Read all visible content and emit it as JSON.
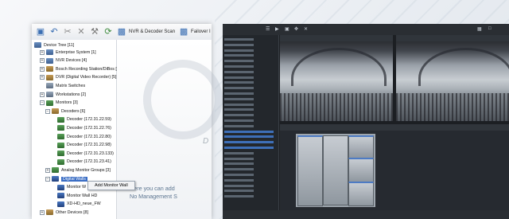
{
  "toolbar": {
    "nvr_decoder_scan_label": "NVR & Decoder Scan",
    "failover_label": "Failover I"
  },
  "tree": {
    "root": "Device Tree [11]",
    "items": [
      {
        "label": "Enterprise System [1]",
        "indent": 1,
        "icon": "enterprise-icon",
        "expand": "+"
      },
      {
        "label": "NVR Devices [4]",
        "indent": 1,
        "icon": "nvr-icon",
        "expand": "+"
      },
      {
        "label": "Bosch Recording Station/DiBos [",
        "indent": 1,
        "icon": "recording-station-icon",
        "expand": "+"
      },
      {
        "label": "DVR (Digital Video Recorder) [5]",
        "indent": 1,
        "icon": "dvr-icon",
        "expand": "+"
      },
      {
        "label": "Matrix Switches",
        "indent": 1,
        "icon": "matrix-switch-icon",
        "expand": ""
      },
      {
        "label": "Workstations [2]",
        "indent": 1,
        "icon": "workstation-icon",
        "expand": "+"
      },
      {
        "label": "Monitors [3]",
        "indent": 1,
        "icon": "monitor-icon",
        "expand": "−"
      },
      {
        "label": "Decoders [6]",
        "indent": 2,
        "icon": "decoder-group-icon",
        "expand": "−"
      },
      {
        "label": "Decoder (172.31.22.59)",
        "indent": 3,
        "icon": "decoder-icon",
        "expand": ""
      },
      {
        "label": "Decoder (172.31.22.76)",
        "indent": 3,
        "icon": "decoder-icon",
        "expand": ""
      },
      {
        "label": "Decoder (172.31.22.80)",
        "indent": 3,
        "icon": "decoder-icon",
        "expand": ""
      },
      {
        "label": "Decoder (172.31.22.98)",
        "indent": 3,
        "icon": "decoder-icon",
        "expand": ""
      },
      {
        "label": "Decoder (172.31.23.133)",
        "indent": 3,
        "icon": "decoder-icon",
        "expand": ""
      },
      {
        "label": "Decoder (172.31.23.41)",
        "indent": 3,
        "icon": "decoder-icon",
        "expand": ""
      },
      {
        "label": "Analog Monitor Groups [3]",
        "indent": 2,
        "icon": "analog-monitor-icon",
        "expand": "+"
      },
      {
        "label": "Digital Walls",
        "indent": 2,
        "icon": "digital-wall-icon",
        "expand": "−",
        "selected": true
      },
      {
        "label": "Monitor W",
        "indent": 3,
        "icon": "monitor-wall-icon",
        "expand": ""
      },
      {
        "label": "Monitor Wall HD",
        "indent": 3,
        "icon": "monitor-wall-icon",
        "expand": ""
      },
      {
        "label": "XD-HD_neue_FW",
        "indent": 3,
        "icon": "monitor-wall-icon",
        "expand": ""
      },
      {
        "label": "Other Devices [8]",
        "indent": 1,
        "icon": "other-devices-icon",
        "expand": "+"
      }
    ]
  },
  "context_menu": {
    "item": "Add Monitor Wall"
  },
  "main": {
    "message_line1": "Here you can add",
    "message_line2": "No Management S",
    "deco_letter": "D"
  },
  "colors": {
    "selection": "#3a6dc4",
    "dark_bg": "#1c1f23",
    "message_text": "#5c7590"
  }
}
